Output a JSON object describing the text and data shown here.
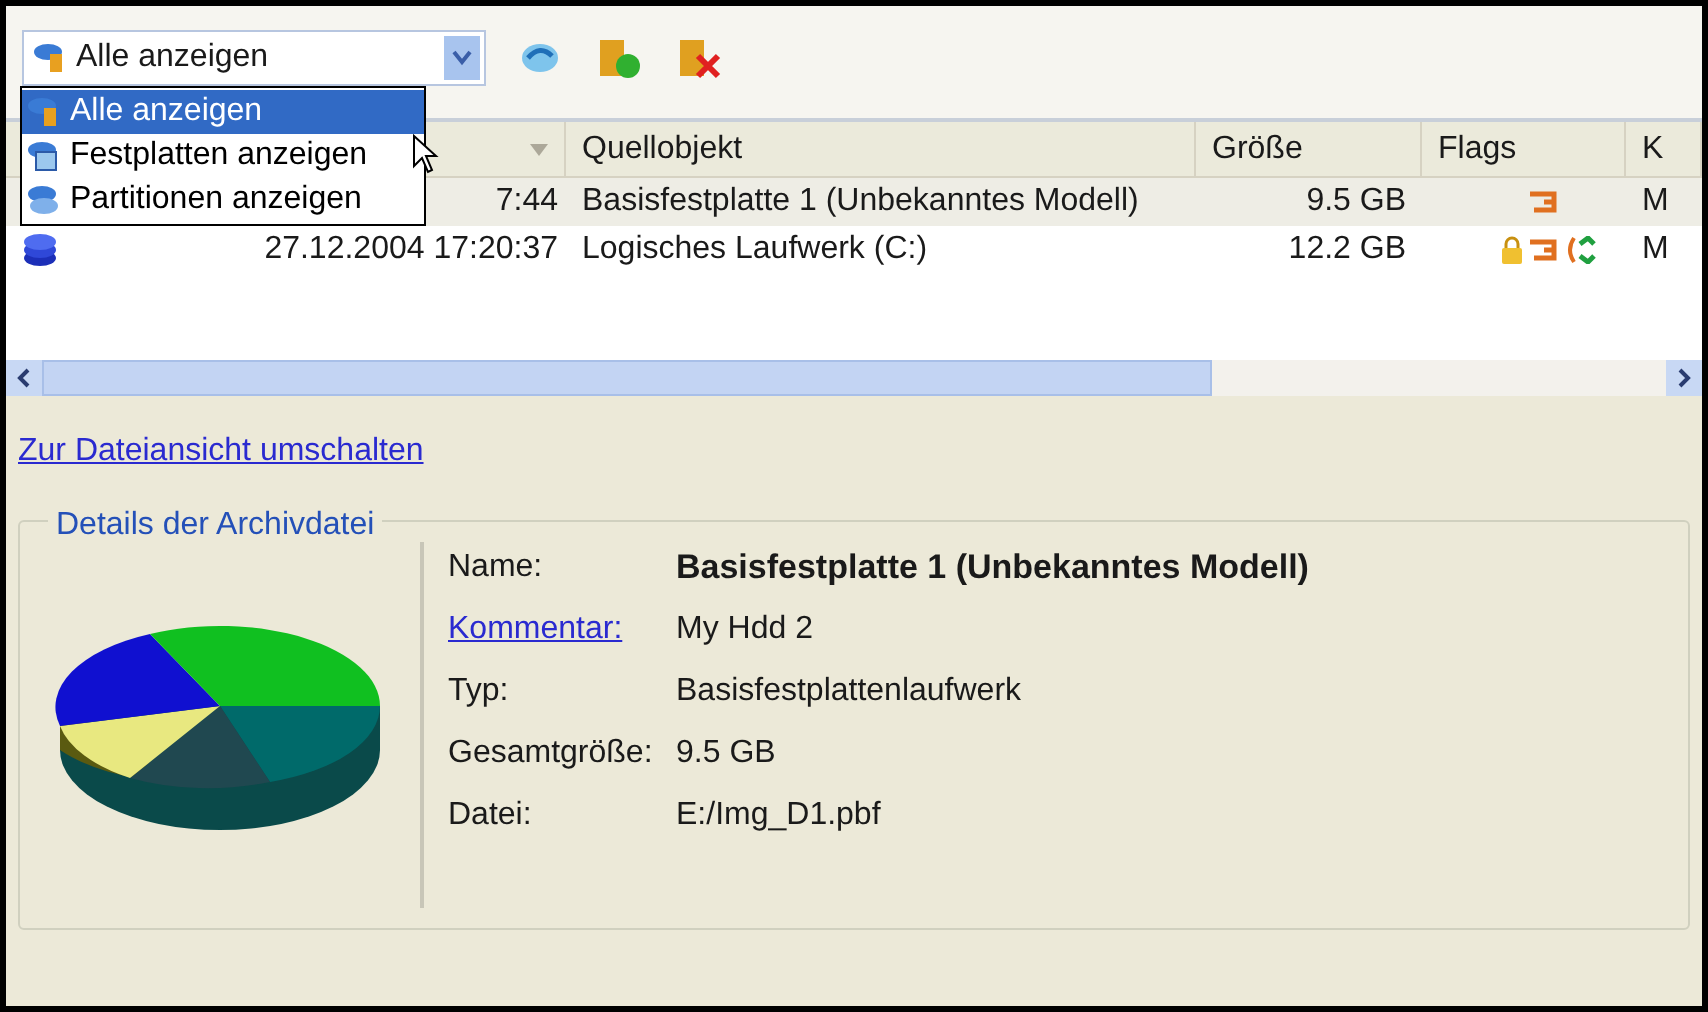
{
  "toolbar": {
    "view_select": {
      "value": "Alle anzeigen",
      "expanded": true,
      "options": [
        {
          "label": "Alle anzeigen",
          "selected": true
        },
        {
          "label": "Festplatten anzeigen",
          "selected": false
        },
        {
          "label": "Partitionen anzeigen",
          "selected": false
        }
      ]
    }
  },
  "table": {
    "columns": [
      "Quellobjekt",
      "Größe",
      "Flags",
      "K"
    ],
    "rows": [
      {
        "date": "7:44",
        "source": "Basisfestplatte 1 (Unbekanntes Modell)",
        "size": "9.5 GB",
        "flags": {
          "lock": false,
          "link": true,
          "sync": false
        },
        "column_5": "M",
        "selected": true
      },
      {
        "date": "27.12.2004 17:20:37",
        "source": "Logisches Laufwerk (C:)",
        "size": "12.2 GB",
        "flags": {
          "lock": true,
          "link": true,
          "sync": true
        },
        "column_5": "M",
        "selected": false
      }
    ]
  },
  "switch_link": "Zur Dateiansicht umschalten",
  "details": {
    "title": "Details der Archivdatei",
    "fields": [
      {
        "label": "Name:",
        "value": "Basisfestplatte 1 (Unbekanntes Modell)",
        "kind": "bold"
      },
      {
        "label": "Kommentar:",
        "value": "My Hdd 2",
        "kind": "link"
      },
      {
        "label": "Typ:",
        "value": "Basisfestplattenlaufwerk",
        "kind": "plain"
      },
      {
        "label": "Gesamtgröße:",
        "value": "9.5 GB",
        "kind": "plain"
      },
      {
        "label": "Datei:",
        "value": "E:/Img_D1.pbf",
        "kind": "plain"
      }
    ]
  }
}
